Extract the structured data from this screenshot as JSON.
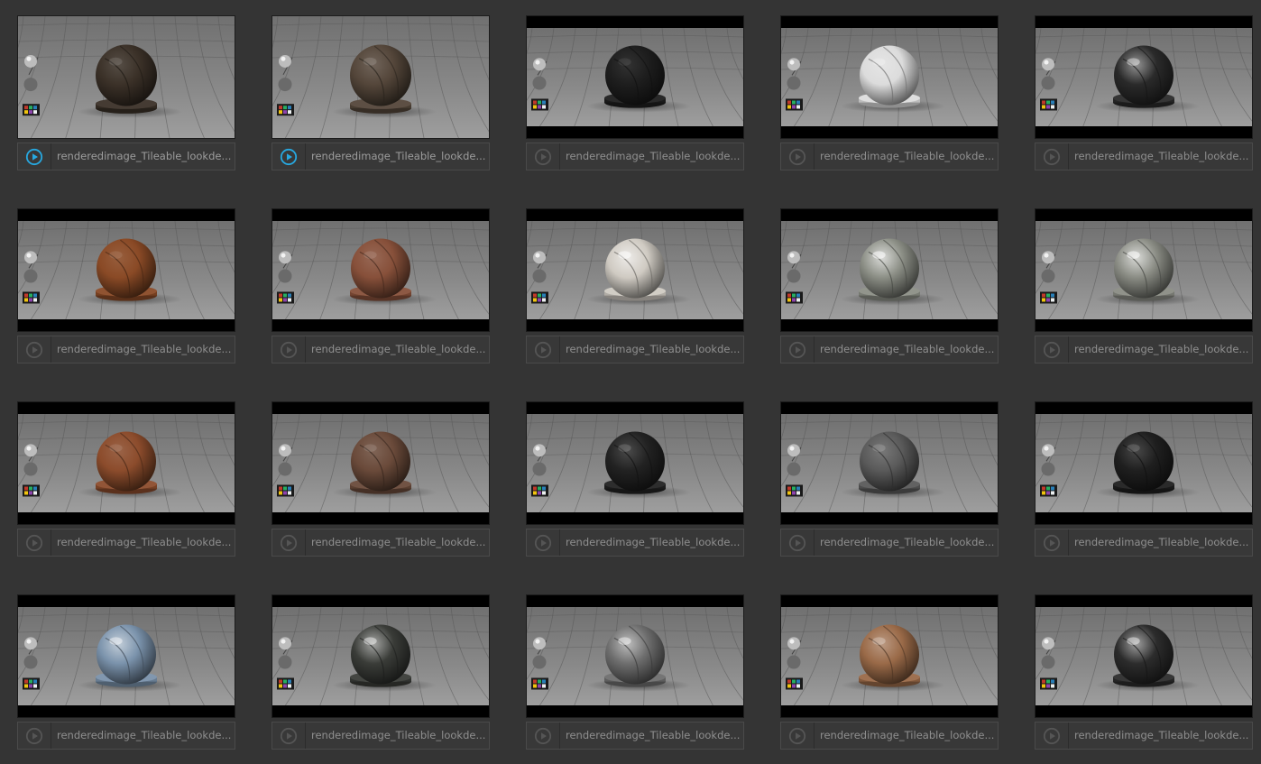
{
  "browser": {
    "items": [
      {
        "name": "renderedimage_Tileable_lookde...",
        "active": true,
        "letterbox": false,
        "material": "dark-brown-leather",
        "color": "#3b3128",
        "sheen": 0.15
      },
      {
        "name": "renderedimage_Tileable_lookde...",
        "active": true,
        "letterbox": false,
        "material": "brown-leather",
        "color": "#54463a",
        "sheen": 0.18
      },
      {
        "name": "renderedimage_Tileable_lookde...",
        "active": false,
        "letterbox": true,
        "material": "black-matte",
        "color": "#1e1e1e",
        "sheen": 0.1
      },
      {
        "name": "renderedimage_Tileable_lookde...",
        "active": false,
        "letterbox": true,
        "material": "white-plastic",
        "color": "#dcdcdc",
        "sheen": 0.3
      },
      {
        "name": "renderedimage_Tileable_lookde...",
        "active": false,
        "letterbox": true,
        "material": "black-glossy-leather",
        "color": "#2a2a2a",
        "sheen": 0.55
      },
      {
        "name": "renderedimage_Tileable_lookde...",
        "active": false,
        "letterbox": true,
        "material": "orange-leather",
        "color": "#8a4a26",
        "sheen": 0.12
      },
      {
        "name": "renderedimage_Tileable_lookde...",
        "active": false,
        "letterbox": true,
        "material": "rust-leather",
        "color": "#87503a",
        "sheen": 0.15
      },
      {
        "name": "renderedimage_Tileable_lookde...",
        "active": false,
        "letterbox": true,
        "material": "pearl-metal",
        "color": "#cfcac2",
        "sheen": 0.7
      },
      {
        "name": "renderedimage_Tileable_lookde...",
        "active": false,
        "letterbox": true,
        "material": "silver-metal",
        "color": "#8c8f86",
        "sheen": 0.75
      },
      {
        "name": "renderedimage_Tileable_lookde...",
        "active": false,
        "letterbox": true,
        "material": "silver-metal",
        "color": "#8a8c84",
        "sheen": 0.75
      },
      {
        "name": "renderedimage_Tileable_lookde...",
        "active": false,
        "letterbox": true,
        "material": "orange-leather",
        "color": "#8c4c2c",
        "sheen": 0.14
      },
      {
        "name": "renderedimage_Tileable_lookde...",
        "active": false,
        "letterbox": true,
        "material": "brown-leather",
        "color": "#6a4a3a",
        "sheen": 0.16
      },
      {
        "name": "renderedimage_Tileable_lookde...",
        "active": false,
        "letterbox": true,
        "material": "black-leather",
        "color": "#222222",
        "sheen": 0.2
      },
      {
        "name": "renderedimage_Tileable_lookde...",
        "active": false,
        "letterbox": true,
        "material": "grey-leather",
        "color": "#5a5a5a",
        "sheen": 0.2
      },
      {
        "name": "renderedimage_Tileable_lookde...",
        "active": false,
        "letterbox": true,
        "material": "black-leather",
        "color": "#1f1f1f",
        "sheen": 0.2
      },
      {
        "name": "renderedimage_Tileable_lookde...",
        "active": false,
        "letterbox": true,
        "material": "blue-glossy",
        "color": "#7a92ab",
        "sheen": 0.6
      },
      {
        "name": "renderedimage_Tileable_lookde...",
        "active": false,
        "letterbox": true,
        "material": "dark-metal",
        "color": "#3a3c38",
        "sheen": 0.6
      },
      {
        "name": "renderedimage_Tileable_lookde...",
        "active": false,
        "letterbox": true,
        "material": "grey-metal",
        "color": "#6e6e6e",
        "sheen": 0.6
      },
      {
        "name": "renderedimage_Tileable_lookde...",
        "active": false,
        "letterbox": true,
        "material": "rusted-metal",
        "color": "#9a6a48",
        "sheen": 0.35
      },
      {
        "name": "renderedimage_Tileable_lookde...",
        "active": false,
        "letterbox": true,
        "material": "dark-glossy-metal",
        "color": "#2c2c2c",
        "sheen": 0.6
      }
    ]
  },
  "colors": {
    "background": "#343434",
    "play_active": "#27a8e0",
    "play_inactive": "#555555",
    "label_text": "#8f8f8f"
  },
  "icons": {
    "play": "play-circle-icon"
  }
}
